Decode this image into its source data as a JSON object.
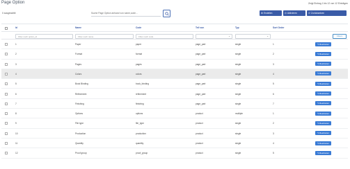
{
  "header": {
    "title": "Page Option",
    "entries_info": "Zeigt Eintrag 1 bis 12 von 12 Einträgen"
  },
  "toolbar": {
    "selected_count": "0 ausgewählt",
    "search_placeholder": "Suche Page Option anhand von name,code...",
    "create_label": "Erstellen",
    "activate_label": "Aktivieren",
    "reset_label": "Zurücksetzen",
    "colors": {
      "primary": "#3a5ba7",
      "edit": "#3a7bd5",
      "filter_button": "#4a90c8"
    }
  },
  "table": {
    "headers": {
      "id": "Id",
      "name": "Name",
      "code": "Code",
      "tell_von": "Teil von",
      "typ": "Typ",
      "sort_order": "Sort Order"
    },
    "filters": {
      "id_placeholder": "Filter nach option_id",
      "name_placeholder": "Filter nach name",
      "code_placeholder": "Filter nach code",
      "filter_button": "Filters"
    },
    "edit_label": "Bearbeiten",
    "rows": [
      {
        "id": "1",
        "name": "Paper",
        "code": "paper",
        "part_of": "page_part",
        "type": "single",
        "sort": "1"
      },
      {
        "id": "2",
        "name": "Format",
        "code": "format",
        "part_of": "page_part",
        "type": "single",
        "sort": "2"
      },
      {
        "id": "3",
        "name": "Pages",
        "code": "pages",
        "part_of": "page_part",
        "type": "single",
        "sort": "3"
      },
      {
        "id": "4",
        "name": "Colors",
        "code": "colors",
        "part_of": "page_part",
        "type": "single",
        "sort": "4"
      },
      {
        "id": "5",
        "name": "Book Binding",
        "code": "book_binding",
        "part_of": "page_part",
        "type": "single",
        "sort": "5"
      },
      {
        "id": "6",
        "name": "Refinement",
        "code": "refinement",
        "part_of": "page_part",
        "type": "single",
        "sort": "6"
      },
      {
        "id": "7",
        "name": "Finishing",
        "code": "finishing",
        "part_of": "page_part",
        "type": "single",
        "sort": "7"
      },
      {
        "id": "8",
        "name": "Options",
        "code": "options",
        "part_of": "product",
        "type": "multiple",
        "sort": "1"
      },
      {
        "id": "9",
        "name": "File type",
        "code": "file_type",
        "part_of": "product",
        "type": "single",
        "sort": "2"
      },
      {
        "id": "10",
        "name": "Production",
        "code": "production",
        "part_of": "product",
        "type": "single",
        "sort": "3"
      },
      {
        "id": "11",
        "name": "Quantity",
        "code": "quantity",
        "part_of": "product",
        "type": "single",
        "sort": "4"
      },
      {
        "id": "12",
        "name": "Proof group",
        "code": "proof_group",
        "part_of": "product",
        "type": "single",
        "sort": "5"
      }
    ],
    "highlighted_row_id": "4"
  }
}
